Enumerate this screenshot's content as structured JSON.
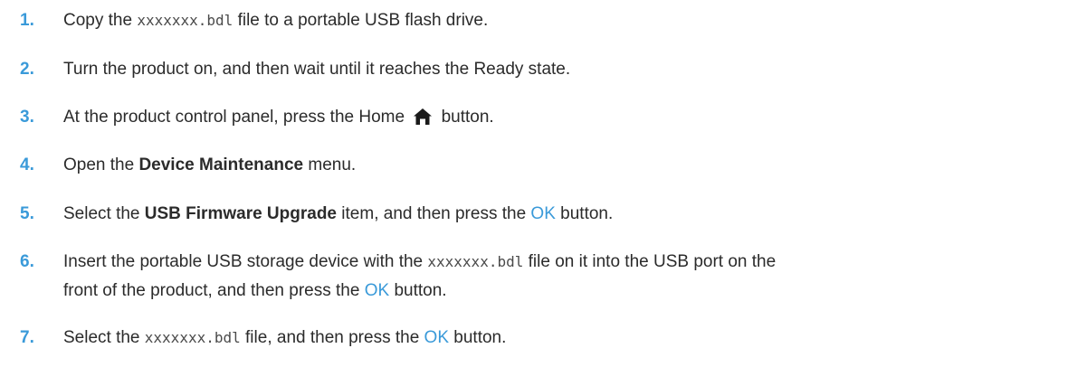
{
  "steps": [
    {
      "number": "1.",
      "parts": [
        "Copy the ",
        "xxxxxxx.bdl",
        " file to a portable USB flash drive."
      ]
    },
    {
      "number": "2.",
      "parts": [
        "Turn the product on, and then wait until it reaches the Ready state."
      ]
    },
    {
      "number": "3.",
      "parts": [
        "At the product control panel, press the Home ",
        " button."
      ],
      "icon": "home-icon"
    },
    {
      "number": "4.",
      "parts": [
        "Open the ",
        "Device Maintenance",
        " menu."
      ]
    },
    {
      "number": "5.",
      "parts": [
        "Select the ",
        "USB Firmware Upgrade",
        " item, and then press the ",
        "OK",
        " button."
      ]
    },
    {
      "number": "6.",
      "parts": [
        "Insert the portable USB storage device with the ",
        "xxxxxxx.bdl",
        " file on it into the USB port on the",
        "front of the product, and then press the ",
        "OK",
        " button."
      ]
    },
    {
      "number": "7.",
      "parts": [
        "Select the ",
        "xxxxxxx.bdl",
        " file, and then press the ",
        "OK",
        " button."
      ]
    }
  ],
  "colors": {
    "accent": "#3a9ad9",
    "text": "#2b2b2b"
  }
}
